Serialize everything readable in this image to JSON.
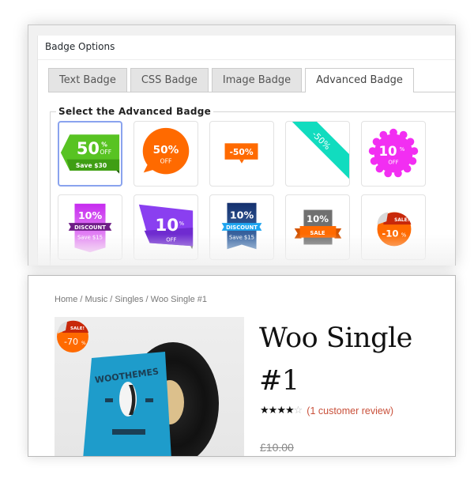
{
  "badge_options": {
    "title": "Badge Options",
    "tabs": [
      {
        "label": "Text Badge",
        "active": false
      },
      {
        "label": "CSS Badge",
        "active": false
      },
      {
        "label": "Image Badge",
        "active": false
      },
      {
        "label": "Advanced Badge",
        "active": true
      }
    ],
    "section_legend": "Select the Advanced Badge",
    "badges": [
      {
        "id": "green-arrow",
        "selected": true,
        "main": "50",
        "unit": "%",
        "sub": "OFF",
        "extra": "Save $30",
        "color": "#4cb81a"
      },
      {
        "id": "orange-bubble",
        "selected": false,
        "main": "50%",
        "sub": "OFF",
        "color": "#ff6a00"
      },
      {
        "id": "orange-tag",
        "selected": false,
        "main": "-50%",
        "color": "#ff6a00"
      },
      {
        "id": "teal-corner-ribbon",
        "selected": false,
        "main": "-50%",
        "color": "#11dcbf"
      },
      {
        "id": "magenta-seal",
        "selected": false,
        "main": "10",
        "unit": "%",
        "sub": "OFF",
        "color": "#f22ef2"
      },
      {
        "id": "purple-discount-ribbon",
        "selected": false,
        "main": "10%",
        "sub": "DISCOUNT",
        "extra": "Save $15",
        "color": "#c23bef"
      },
      {
        "id": "violet-banner",
        "selected": false,
        "main": "10",
        "unit": "%",
        "sub": "OFF",
        "color": "#8a3ff0"
      },
      {
        "id": "navy-discount-ribbon",
        "selected": false,
        "main": "10%",
        "sub": "DISCOUNT",
        "extra": "Save $15",
        "color": "#1b3d86"
      },
      {
        "id": "grey-sale-ribbon",
        "selected": false,
        "main": "10%",
        "sub": "SALE",
        "color": "#707070"
      },
      {
        "id": "orange-sticker",
        "selected": false,
        "main": "-10",
        "unit": "%",
        "sub": "SALE!",
        "color": "#ff6a00"
      }
    ]
  },
  "product": {
    "breadcrumb": [
      "Home",
      "Music",
      "Singles",
      "Woo Single #1"
    ],
    "breadcrumb_separator": " / ",
    "title": "Woo Single #1",
    "sale_badge": {
      "label": "SALE!",
      "value": "-70",
      "unit": "%"
    },
    "image_text": "WOOTHEMES",
    "rating": {
      "value": 4,
      "max": 5
    },
    "review_link": "(1 customer review)",
    "old_price": "£10.00",
    "colors": {
      "review_link": "#c9503a",
      "sleeve": "#1e9ccb"
    }
  }
}
